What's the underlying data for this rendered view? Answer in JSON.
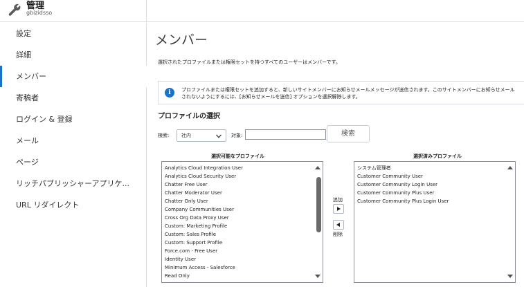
{
  "header": {
    "title": "管理",
    "subtitle": "gbizidsso"
  },
  "sidebar": {
    "items": [
      {
        "label": "設定"
      },
      {
        "label": "詳細"
      },
      {
        "label": "メンバー"
      },
      {
        "label": "寄稿者"
      },
      {
        "label": "ログイン & 登録"
      },
      {
        "label": "メール"
      },
      {
        "label": "ページ"
      },
      {
        "label": "リッチパブリッシャーアプリケ..."
      },
      {
        "label": "URL リダイレクト"
      }
    ],
    "active_index": 2
  },
  "main": {
    "title": "メンバー",
    "description": "選択されたプロファイルまたは権限セットを持つすべてのユーザーはメンバーです。",
    "info_line1": "プロファイルまたは権限セットを追加すると、新しいサイトメンバーにお知らせメールメッセージが送信されます。このサイトメンバーにお知らせメール",
    "info_line2": "されないようにするには、[お知らせメールを送信] オプションを選択解除します。",
    "section_title": "プロファイルの選択",
    "search_label": "検索:",
    "search_select_value": "社内",
    "target_label": "対象:",
    "search_input_value": "",
    "search_button": "検索",
    "available_header": "選択可能なプロファイル",
    "selected_header": "選択済みプロファイル",
    "add_label": "追加",
    "remove_label": "削除",
    "available_profiles": [
      "Analytics Cloud Integration User",
      "Analytics Cloud Security User",
      "Chatter Free User",
      "Chatter Moderator User",
      "Chatter Only User",
      "Company Communities User",
      "Cross Org Data Proxy User",
      "Custom: Marketing Profile",
      "Custom: Sales Profile",
      "Custom: Support Profile",
      "Force.com - Free User",
      "Identity User",
      "Minimum Access - Salesforce",
      "Read Only"
    ],
    "selected_profiles": [
      "システム管理者",
      "Customer Community User",
      "Customer Community Login User",
      "Customer Community Plus User",
      "Customer Community Plus Login User"
    ]
  },
  "colors": {
    "accent": "#1a73c8",
    "border": "#d8dde6"
  }
}
